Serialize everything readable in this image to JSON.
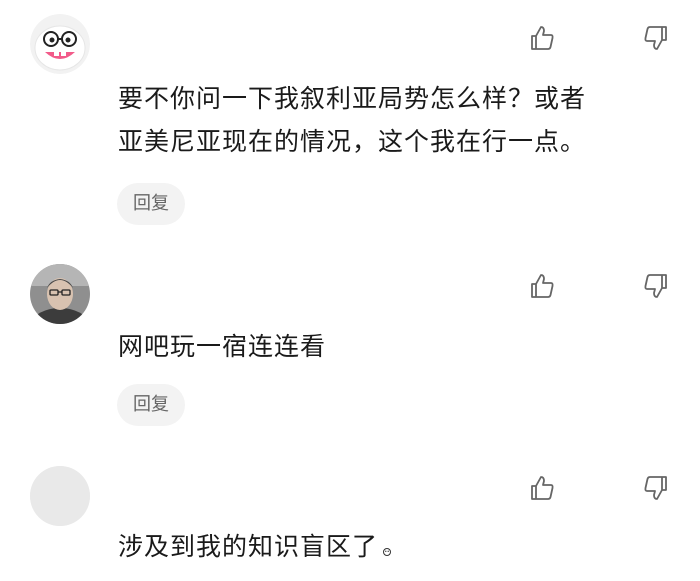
{
  "comments": [
    {
      "avatar": "cartoon-face-avatar",
      "text_lines": [
        "要不你问一下我叙利亚局势怎么样？或者",
        "亚美尼亚现在的情况，这个我在行一点。"
      ],
      "reply_label": "回复"
    },
    {
      "avatar": "photo-avatar",
      "text_lines": [
        "网吧玩一宿连连看"
      ],
      "reply_label": "回复"
    },
    {
      "avatar": "placeholder-avatar",
      "text_lines": [
        "涉及到我的知识盲区了"
      ],
      "reply_label": ""
    }
  ],
  "icons": {
    "like": "thumbs-up-outline-icon",
    "dislike": "thumbs-down-outline-icon"
  },
  "colors": {
    "icon_stroke": "#666666",
    "reply_bg": "#f3f3f3",
    "reply_text": "#666666",
    "placeholder_avatar": "#e9e9e9"
  }
}
